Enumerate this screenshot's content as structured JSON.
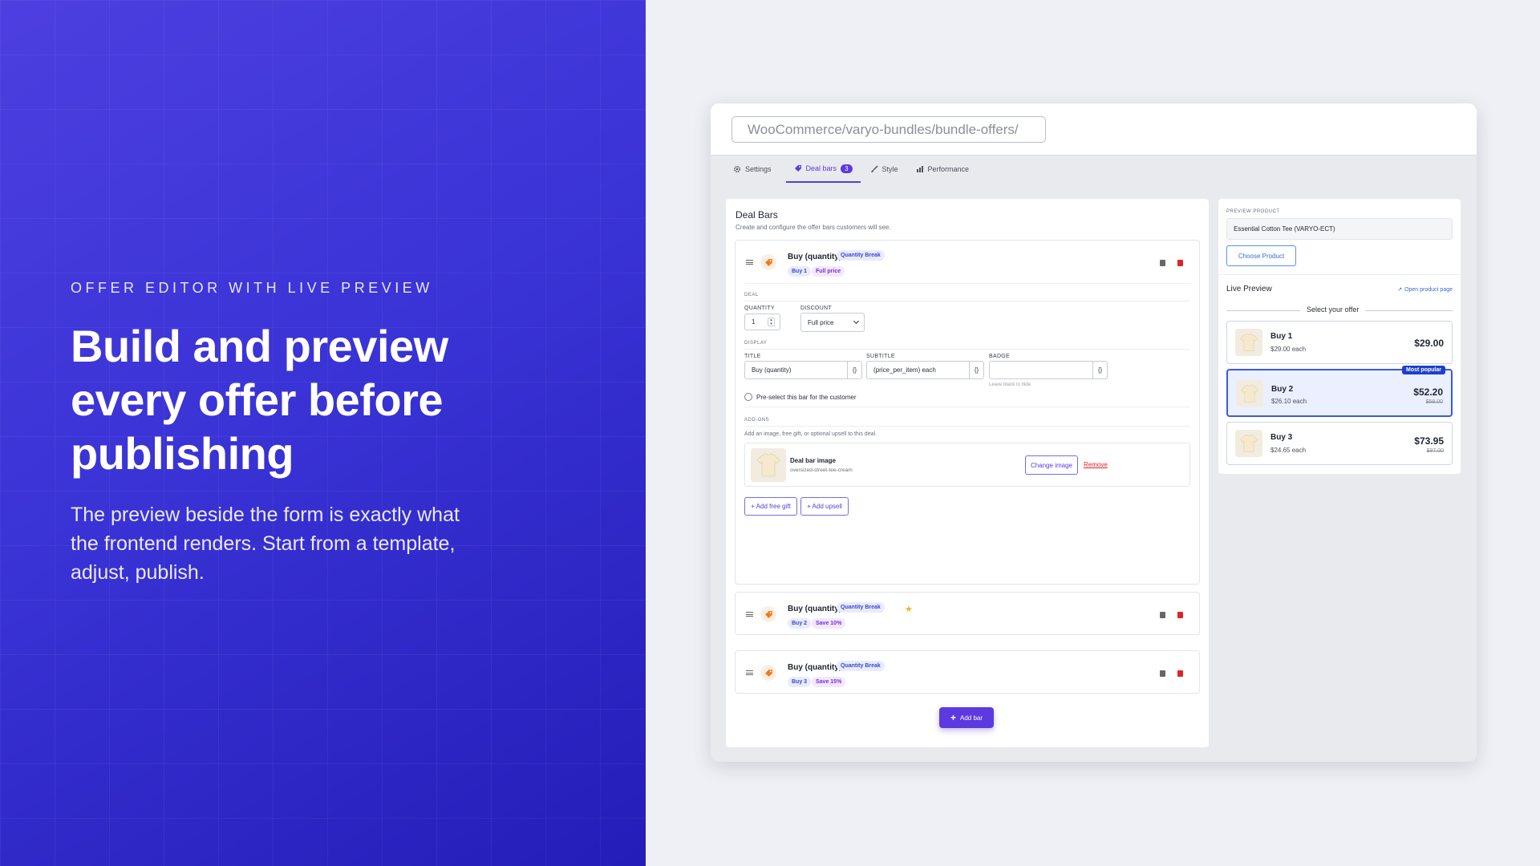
{
  "hero": {
    "eyebrow": "OFFER EDITOR WITH LIVE PREVIEW",
    "title": "Build and preview every offer before publishing",
    "body": "The preview beside the form is exactly what the frontend renders. Start from a template, adjust, publish."
  },
  "browser": {
    "url": "WooCommerce/varyo-bundles/bundle-offers/"
  },
  "tabs": [
    {
      "label": "Settings",
      "icon": "gear-icon"
    },
    {
      "label": "Deal bars",
      "icon": "tag-icon",
      "count": "3",
      "active": true
    },
    {
      "label": "Style",
      "icon": "brush-icon"
    },
    {
      "label": "Performance",
      "icon": "bar-chart-icon"
    }
  ],
  "deal_bars": {
    "title": "Deal Bars",
    "subtitle": "Create and configure the offer bars customers will see.",
    "add_bar_label": "Add bar",
    "bars": [
      {
        "title": "Buy (quantity)",
        "type_chip": "Quantity Break",
        "qty_chip": "Buy 1",
        "discount_chip": "Full price"
      },
      {
        "title": "Buy (quantity)",
        "type_chip": "Quantity Break",
        "qty_chip": "Buy 2",
        "discount_chip": "Save 10%"
      },
      {
        "title": "Buy (quantity)",
        "type_chip": "Quantity Break",
        "qty_chip": "Buy 3",
        "discount_chip": "Save 15%"
      }
    ],
    "editor": {
      "deal_section": "DEAL",
      "quantity_label": "QUANTITY",
      "quantity_value": "1",
      "discount_label": "DISCOUNT",
      "discount_value": "Full price",
      "display_section": "DISPLAY",
      "title_label": "TITLE",
      "title_value": "Buy (quantity)",
      "subtitle_label": "SUBTITLE",
      "subtitle_value": "(price_per_item) each",
      "badge_label": "BADGE",
      "badge_value": "",
      "badge_hint": "Leave blank to hide",
      "brace": "{}",
      "preselect_label": "Pre-select this bar for the customer",
      "addons_section": "ADD-ONS",
      "addons_desc": "Add an image, free gift, or optional upsell to this deal.",
      "image_title": "Deal bar image",
      "image_file": "oversized-street-tee-cream",
      "change_image": "Change image",
      "remove": "Remove",
      "add_free_gift": "+ Add free gift",
      "add_upsell": "+ Add upsell"
    }
  },
  "preview": {
    "product_label": "PREVIEW PRODUCT",
    "product_value": "Essential Cotton Tee (VARYO-ECT)",
    "choose_product": "Choose Product",
    "live_preview": "Live Preview",
    "open_product_page": "Open product page",
    "select_offer": "Select your offer",
    "offers": [
      {
        "name": "Buy 1",
        "each": "$29.00 each",
        "price": "$29.00",
        "strike": "",
        "badge": ""
      },
      {
        "name": "Buy 2",
        "each": "$26.10 each",
        "price": "$52.20",
        "strike": "$58.00",
        "badge": "Most popular",
        "selected": true
      },
      {
        "name": "Buy 3",
        "each": "$24.65 each",
        "price": "$73.95",
        "strike": "$87.00",
        "badge": ""
      }
    ]
  },
  "colors": {
    "accent": "#5b3ae0",
    "hero_bg": "#3a33d6",
    "danger": "#e02424",
    "selected": "#3b5bdb"
  }
}
